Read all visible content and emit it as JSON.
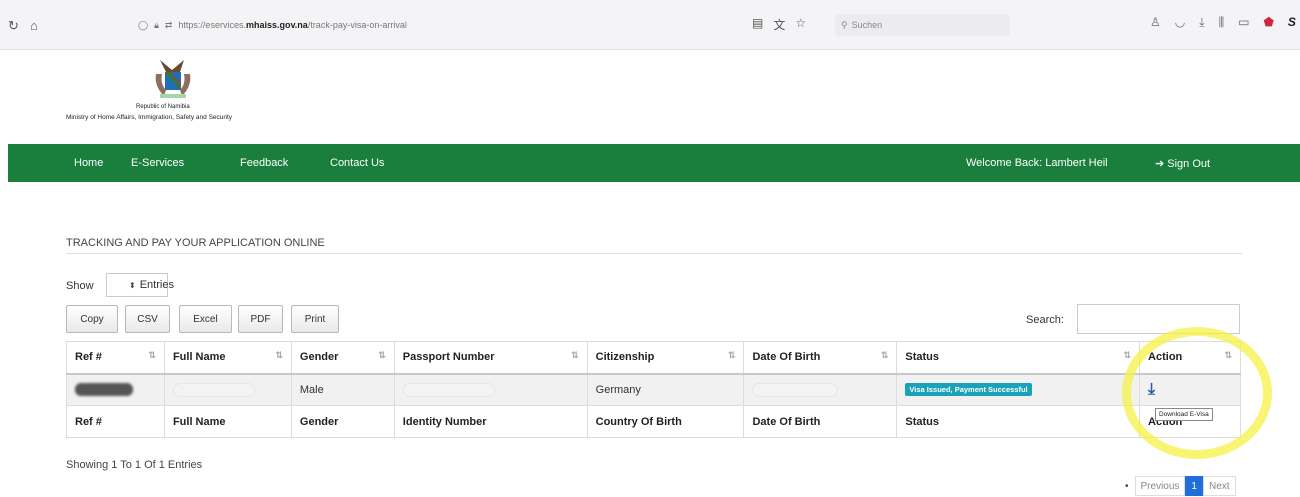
{
  "browser": {
    "url_prefix": "https://eservices.",
    "url_domain": "mhaiss.gov.na",
    "url_path": "/track-pay-visa-on-arrival",
    "search_placeholder": "Suchen"
  },
  "header": {
    "republic": "Republic of Namibia",
    "ministry": "Ministry of Home Affairs, Immigration, Safety and Security"
  },
  "nav": {
    "items": [
      "Home",
      "E-Services",
      "Feedback",
      "Contact Us"
    ],
    "welcome": "Welcome Back: Lambert Heil",
    "sign_out": "Sign Out"
  },
  "page": {
    "title": "TRACKING AND PAY YOUR APPLICATION ONLINE",
    "show_label": "Show",
    "entries_label": "Entries",
    "buttons": [
      "Copy",
      "CSV",
      "Excel",
      "PDF",
      "Print"
    ],
    "search_label": "Search:"
  },
  "table": {
    "columns": [
      "Ref #",
      "Full Name",
      "Gender",
      "Passport Number",
      "Citizenship",
      "Date Of Birth",
      "Status",
      "Action"
    ],
    "row": {
      "gender": "Male",
      "citizenship": "Germany",
      "status": "Visa Issued, Payment Successful"
    },
    "footer_columns": [
      "Ref #",
      "Full Name",
      "Gender",
      "Identity Number",
      "Country Of Birth",
      "Date Of Birth",
      "Status",
      "Action"
    ],
    "tooltip": "Download E-Visa"
  },
  "footer": {
    "showing": "Showing 1 To 1 Of 1 Entries",
    "previous": "Previous",
    "current_page": "1",
    "next": "Next"
  },
  "colors": {
    "nav_green": "#1a7f3c",
    "status_badge": "#1aa3b8",
    "highlight": "#f6f246"
  }
}
